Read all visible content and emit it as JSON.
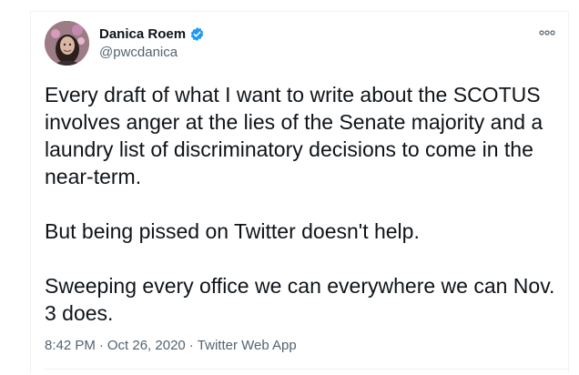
{
  "tweet": {
    "author": {
      "display_name": "Danica Roem",
      "handle": "@pwcdanica",
      "verified": true
    },
    "paragraphs": [
      "Every draft of what I want to write about the SCOTUS involves anger at the lies of the Senate majority and a laundry list of discriminatory decisions to come in the near-term.",
      "But being pissed on Twitter doesn't help.",
      "Sweeping every office we can everywhere we can Nov. 3 does."
    ],
    "time": "8:42 PM",
    "date": "Oct 26, 2020",
    "source": "Twitter Web App",
    "separator": "·"
  },
  "colors": {
    "verified_badge": "#1d9bf0",
    "secondary_text": "#536471",
    "primary_text": "#0f1419"
  },
  "icons": {
    "more": "more-icon",
    "verified": "verified-badge-icon"
  }
}
